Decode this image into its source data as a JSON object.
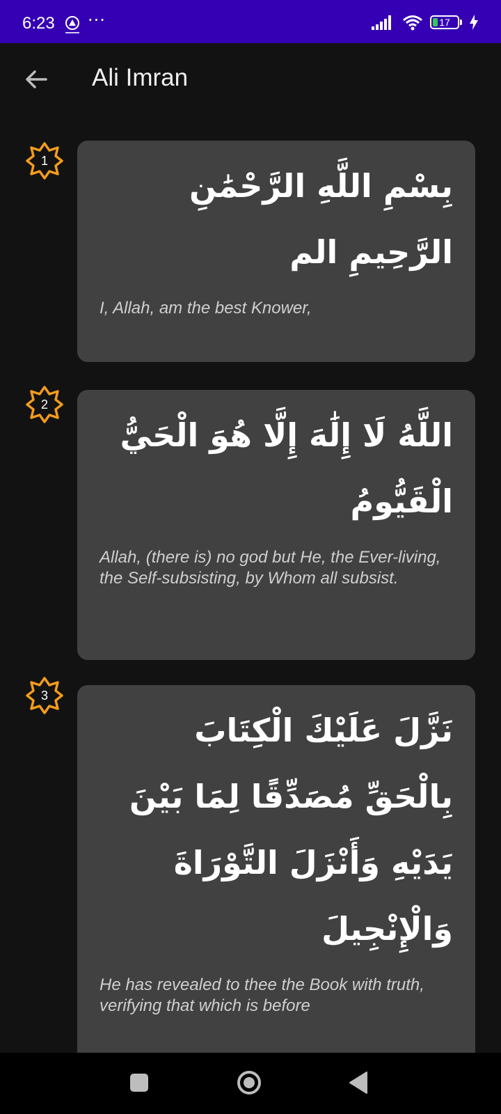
{
  "status_bar": {
    "time": "6:23",
    "battery": "17"
  },
  "app_bar": {
    "title": "Ali Imran"
  },
  "verses": [
    {
      "number": "1",
      "arabic": "بِسْمِ اللَّهِ الرَّحْمَٰنِ الرَّحِيمِ الم",
      "translation": "I, Allah, am the best Knower,"
    },
    {
      "number": "2",
      "arabic": "اللَّهُ لَا إِلَٰهَ إِلَّا هُوَ الْحَيُّ الْقَيُّومُ",
      "translation": "Allah, (there is) no god but He, the Ever-living, the Self-subsisting, by Whom all subsist."
    },
    {
      "number": "3",
      "arabic": "نَزَّلَ عَلَيْكَ الْكِتَابَ بِالْحَقِّ مُصَدِّقًا لِمَا بَيْنَ يَدَيْهِ وَأَنْزَلَ التَّوْرَاةَ وَالْإِنْجِيلَ",
      "translation": "He has revealed to thee the Book with truth, verifying that which is before"
    }
  ],
  "colors": {
    "status_bar": "#3500b3",
    "background": "#121212",
    "card": "#414141",
    "badge": "#f39c1e"
  },
  "icons": {
    "back": "arrow-left-icon",
    "badge": "star-octagon-icon",
    "wifi": "wifi-icon",
    "signal": "signal-icon",
    "charging": "lightning-icon"
  }
}
